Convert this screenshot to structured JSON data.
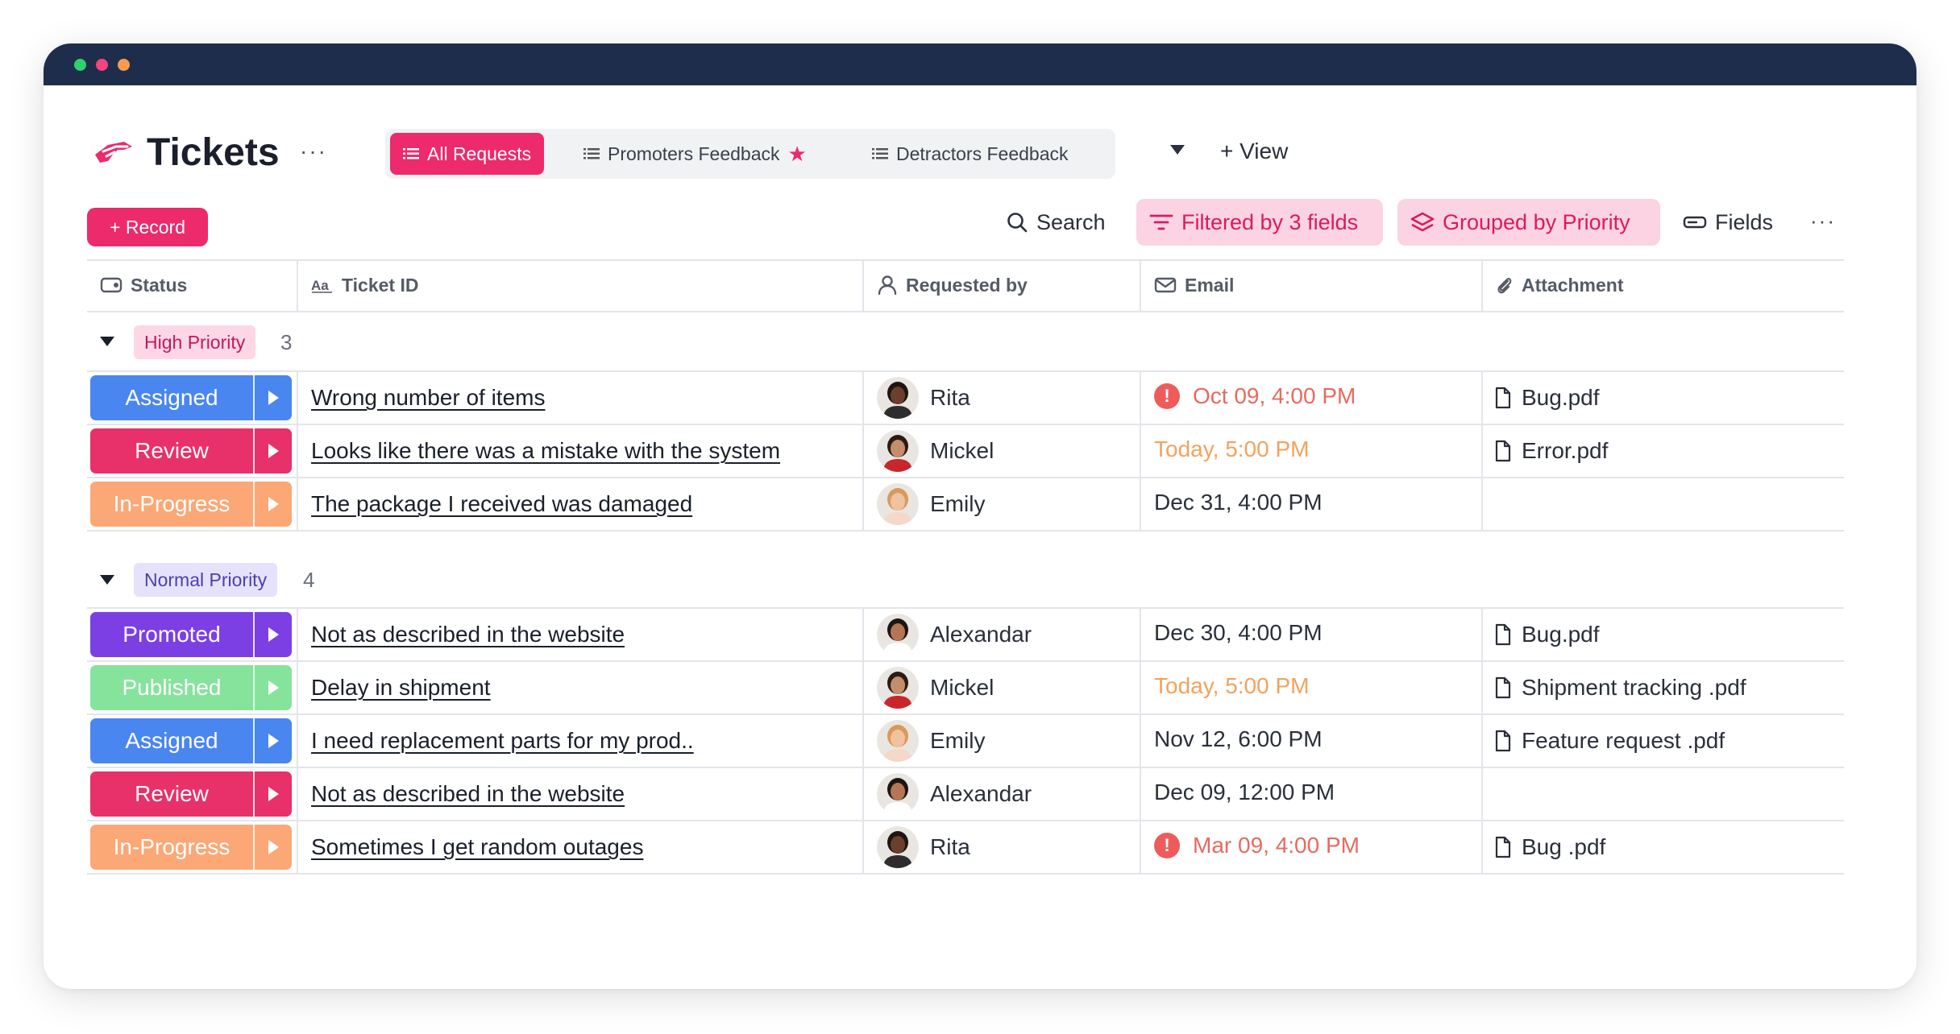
{
  "app": {
    "title": "Tickets",
    "title_more": "···",
    "accent": "#ec2a6c"
  },
  "views": [
    {
      "label": "All Requests",
      "icon": "list-icon",
      "active": true
    },
    {
      "label": "Promoters Feedback",
      "icon": "list-icon",
      "starred": true
    },
    {
      "label": "Detractors Feedback",
      "icon": "list-icon"
    }
  ],
  "add_view_label": "+ View",
  "toolbar": {
    "record_label": "+ Record",
    "search_label": "Search",
    "filter_label": "Filtered by 3 fields",
    "group_label": "Grouped by Priority",
    "fields_label": "Fields",
    "more_label": "···"
  },
  "columns": [
    {
      "label": "Status",
      "icon": "status-icon"
    },
    {
      "label": "Ticket ID",
      "icon": "text-type-icon"
    },
    {
      "label": "Requested by",
      "icon": "person-icon"
    },
    {
      "label": "Email",
      "icon": "envelope-icon"
    },
    {
      "label": "Attachment",
      "icon": "paperclip-icon"
    }
  ],
  "groups": [
    {
      "name": "High Priority",
      "count": "3",
      "rows": [
        {
          "status": "Assigned",
          "status_color": "#4a86f0",
          "ticket": "Wrong number of items",
          "requester": "Rita",
          "email": "Oct 09, 4:00 PM",
          "email_style": "overdue",
          "attachment": "Bug.pdf"
        },
        {
          "status": "Review",
          "status_color": "#e8306a",
          "ticket": "Looks like there was a mistake with the system",
          "requester": "Mickel",
          "email": "Today, 5:00 PM",
          "email_style": "today",
          "attachment": "Error.pdf"
        },
        {
          "status": "In-Progress",
          "status_color": "#fba876",
          "ticket": "The package I received was damaged",
          "requester": "Emily",
          "email": "Dec 31, 4:00 PM",
          "email_style": "normal",
          "attachment": ""
        }
      ]
    },
    {
      "name": "Normal Priority",
      "count": "4",
      "rows": [
        {
          "status": "Promoted",
          "status_color": "#7c3fe4",
          "ticket": "Not as described in the website",
          "requester": "Alexandar",
          "email": "Dec 30, 4:00 PM",
          "email_style": "normal",
          "attachment": "Bug.pdf"
        },
        {
          "status": "Published",
          "status_color": "#86e39c",
          "ticket": "Delay in shipment",
          "requester": "Mickel",
          "email": "Today, 5:00 PM",
          "email_style": "today",
          "attachment": "Shipment tracking .pdf"
        },
        {
          "status": "Assigned",
          "status_color": "#4a86f0",
          "ticket": "I need replacement parts for my prod..",
          "requester": "Emily",
          "email": "Nov 12, 6:00 PM",
          "email_style": "normal",
          "attachment": "Feature request .pdf"
        },
        {
          "status": "Review",
          "status_color": "#e8306a",
          "ticket": "Not as described in the website",
          "requester": "Alexandar",
          "email": "Dec 09, 12:00 PM",
          "email_style": "normal",
          "attachment": ""
        },
        {
          "status": "In-Progress",
          "status_color": "#fba876",
          "ticket": "Sometimes I get random outages",
          "requester": "Rita",
          "email": "Mar 09, 4:00 PM",
          "email_style": "overdue",
          "attachment": "Bug .pdf"
        }
      ]
    }
  ],
  "colors": {
    "overdue": "#e86a5e",
    "today": "#f4a25c",
    "high_priority_badge": "#fdd7e6",
    "normal_priority_badge": "#e6e2fb"
  }
}
